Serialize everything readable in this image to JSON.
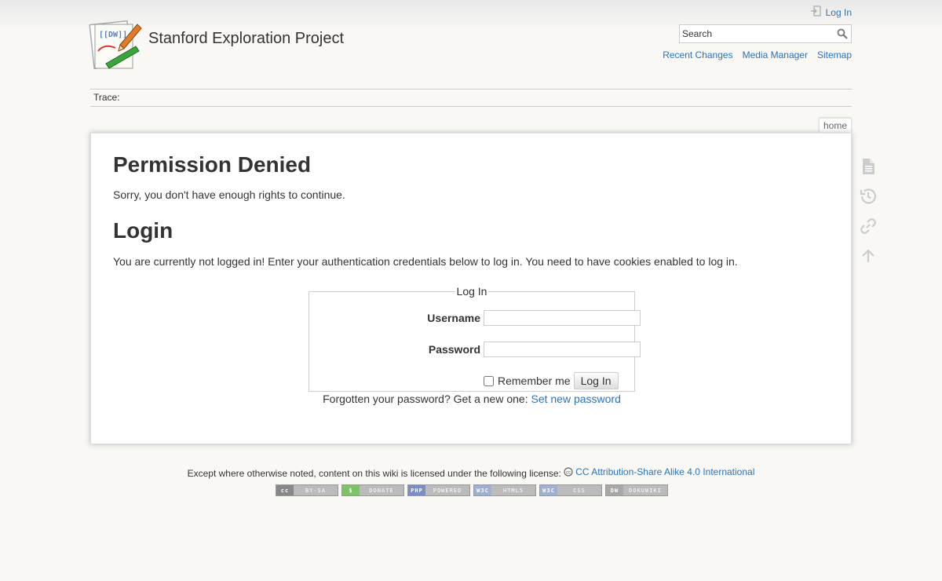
{
  "header": {
    "site_title": "Stanford Exploration Project",
    "logo_text": "[[DW]]",
    "user_tools": {
      "login": "Log In"
    },
    "search": {
      "placeholder": "Search"
    },
    "site_tools": [
      "Recent Changes",
      "Media Manager",
      "Sitemap"
    ]
  },
  "breadcrumbs": {
    "label": "Trace:"
  },
  "page_tab": "home",
  "content": {
    "h1": "Permission Denied",
    "p1": "Sorry, you don't have enough rights to continue.",
    "h2": "Login",
    "p2": "You are currently not logged in! Enter your authentication credentials below to log in. You need to have cookies enabled to log in.",
    "form": {
      "legend": "Log In",
      "username_label": "Username",
      "username_value": "",
      "password_label": "Password",
      "password_value": "",
      "remember_label": "Remember me",
      "remember_checked": false,
      "submit_label": "Log In"
    },
    "forgot": {
      "text": "Forgotten your password? Get a new one: ",
      "link": "Set new password"
    }
  },
  "page_tools": [
    "show-page-icon",
    "old-revisions-icon",
    "backlinks-icon",
    "back-to-top-icon"
  ],
  "footer": {
    "license_text": "Except where otherwise noted, content on this wiki is licensed under the following license:",
    "license_link": "CC Attribution-Share Alike 4.0 International",
    "badges": [
      {
        "left": "cc",
        "right": "BY-SA",
        "color": "#888888"
      },
      {
        "left": "$",
        "right": "DONATE",
        "color": "#7ec26a"
      },
      {
        "left": "PHP",
        "right": "POWERED",
        "color": "#7b8ec4"
      },
      {
        "left": "W3C",
        "right": "HTML5",
        "color": "#9fb0d0"
      },
      {
        "left": "W3C",
        "right": "CSS",
        "color": "#9fb0d0"
      },
      {
        "left": "DW",
        "right": "DOKUWIKI",
        "color": "#a8a8a8"
      }
    ]
  },
  "colors": {
    "link": "#2b73b7",
    "background": "#f9f8f5",
    "text": "#333333"
  }
}
